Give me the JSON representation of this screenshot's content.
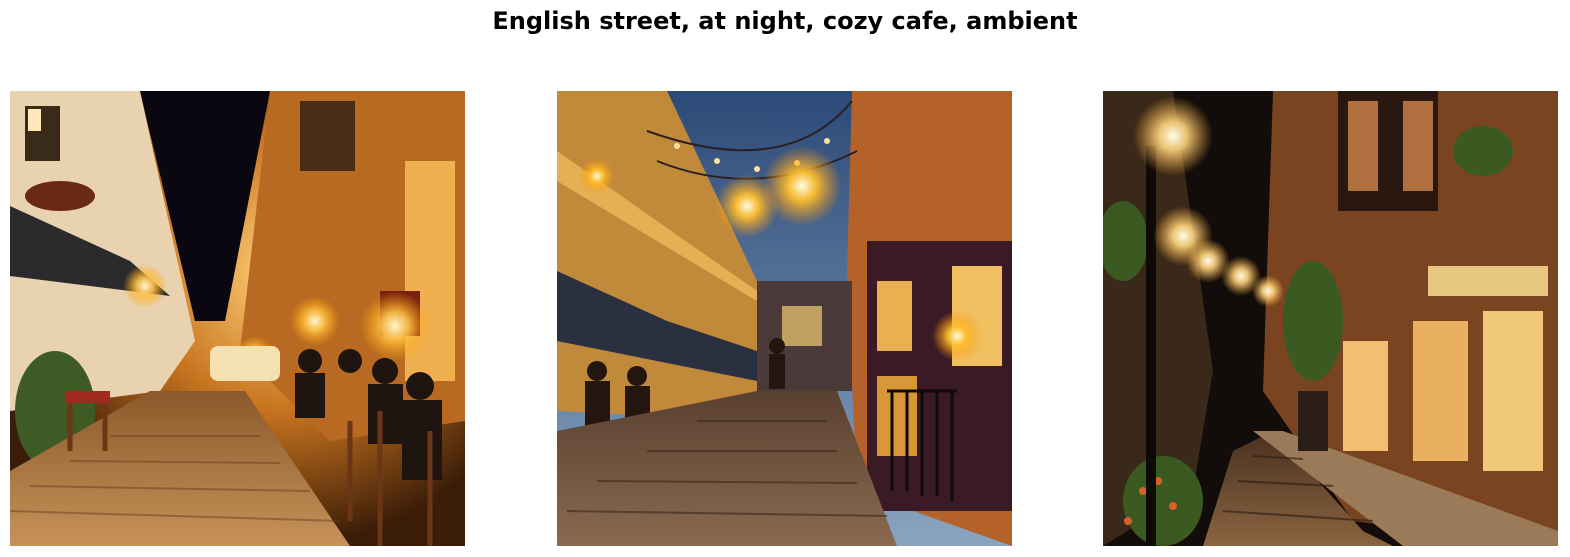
{
  "figure": {
    "title": "English street, at night, cozy cafe, ambient"
  },
  "images": [
    {
      "scene": "cobblestone-street-cafe-night"
    },
    {
      "scene": "cobblestone-street-string-lights-dusk"
    },
    {
      "scene": "cobblestone-street-lamps-night"
    }
  ]
}
